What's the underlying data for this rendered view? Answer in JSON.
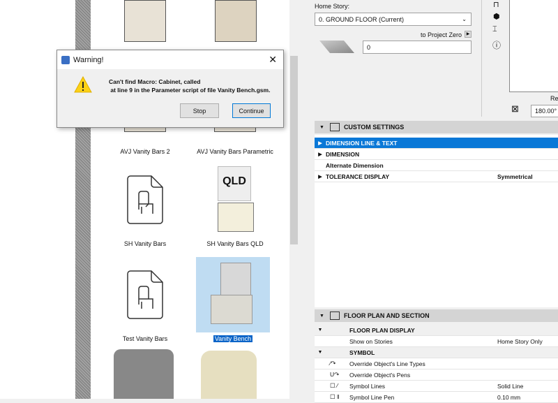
{
  "dialog": {
    "title": "Warning!",
    "message_line1": "Can't find Macro: Cabinet, called",
    "message_line2": " at line 9 in the Parameter script of file Vanity Bench.gsm.",
    "stop_label": "Stop",
    "continue_label": "Continue"
  },
  "library": {
    "items": [
      {
        "label": "AVJ Vanity Bars 2"
      },
      {
        "label": "AVJ Vanity Bars Parametric"
      },
      {
        "label": "SH Vanity Bars"
      },
      {
        "label": "SH Vanity Bars QLD",
        "overlay": "QLD"
      },
      {
        "label": "Test Vanity Bars"
      },
      {
        "label": "Vanity Bench",
        "selected": true
      }
    ]
  },
  "placement": {
    "home_story_label": "Home Story:",
    "home_story_value": "0. GROUND FLOOR (Current)",
    "to_project_zero": "to Project Zero",
    "elevation_value": "0",
    "rotation_label": "Re",
    "rotation_value": "180.00°"
  },
  "custom_settings": {
    "title": "CUSTOM SETTINGS",
    "rows": [
      {
        "label": "DIMENSION LINE & TEXT",
        "value": ""
      },
      {
        "label": "DIMENSION",
        "value": ""
      },
      {
        "label": "Alternate Dimension",
        "value": ""
      },
      {
        "label": "TOLERANCE DISPLAY",
        "value": "Symmetrical"
      }
    ]
  },
  "floor_plan": {
    "title": "FLOOR PLAN AND SECTION",
    "rows": [
      {
        "label": "FLOOR PLAN DISPLAY",
        "value": ""
      },
      {
        "label": "Show on Stories",
        "value": "Home Story Only"
      },
      {
        "label": "SYMBOL",
        "value": ""
      },
      {
        "label": "Override Object's Line Types",
        "value": ""
      },
      {
        "label": "Override Object's Pens",
        "value": ""
      },
      {
        "label": "Symbol Lines",
        "value": "Solid Line"
      },
      {
        "label": "Symbol Line Pen",
        "value": "0.10 mm"
      }
    ]
  },
  "colors": {
    "selection": "#0a78d7",
    "accent": "#0078d7"
  }
}
